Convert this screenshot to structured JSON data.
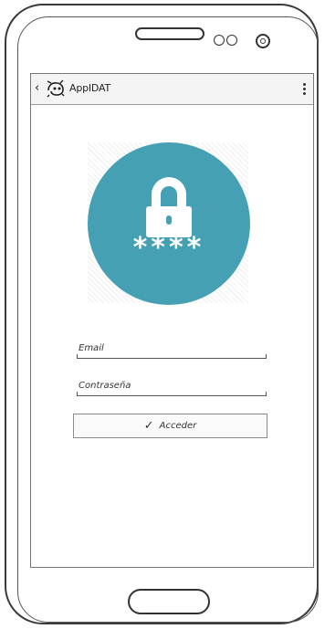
{
  "app_bar": {
    "title": "AppIDAT",
    "back_icon": "chevron-left-icon",
    "logo_icon": "app-logo-icon",
    "menu_icon": "overflow-menu-icon"
  },
  "hero": {
    "icon": "lock-icon",
    "pin_mask": "****",
    "circle_color": "#45a0b4"
  },
  "form": {
    "email_placeholder": "Email",
    "password_placeholder": "Contraseña",
    "submit_label": "Acceder",
    "submit_icon": "check-icon"
  }
}
